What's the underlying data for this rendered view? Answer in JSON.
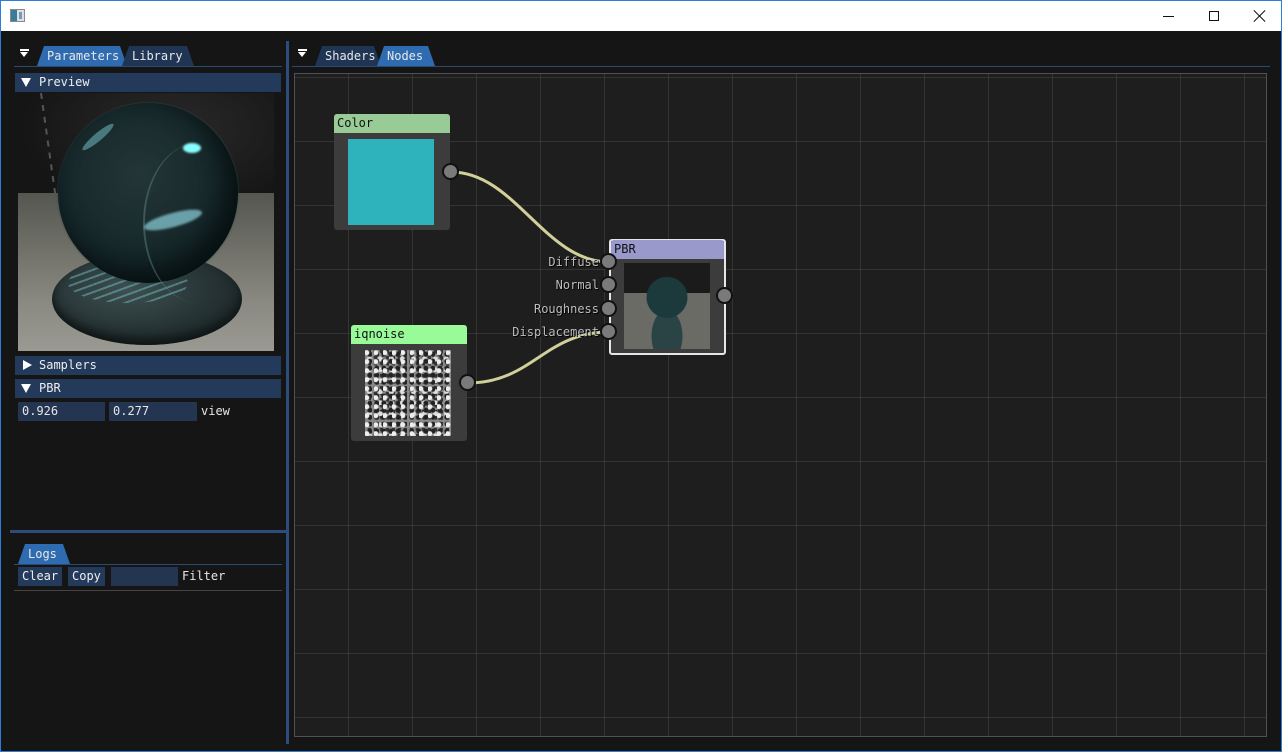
{
  "window": {
    "title": "",
    "controls": {
      "minimize": "minimize",
      "maximize": "maximize",
      "close": "close"
    }
  },
  "left_panel": {
    "tabs": [
      {
        "label": "Parameters",
        "active": true
      },
      {
        "label": "Library",
        "active": false
      }
    ],
    "sections": {
      "preview": {
        "label": "Preview",
        "expanded": true
      },
      "samplers": {
        "label": "Samplers",
        "expanded": false
      },
      "pbr": {
        "label": "PBR",
        "expanded": true
      }
    },
    "pbr_view": {
      "x": "0.926",
      "y": "0.277",
      "label": "view"
    }
  },
  "logs_panel": {
    "tabs": [
      {
        "label": "Logs",
        "active": true
      }
    ],
    "clear_label": "Clear",
    "copy_label": "Copy",
    "filter_value": "",
    "filter_label": "Filter"
  },
  "right_panel": {
    "tabs": [
      {
        "label": "Shaders",
        "active": false
      },
      {
        "label": "Nodes",
        "active": true
      }
    ]
  },
  "nodes": {
    "color": {
      "title": "Color",
      "title_color": "#98cb95",
      "swatch": "#2eb2bb"
    },
    "iqnoise": {
      "title": "iqnoise",
      "title_color": "#98fb98"
    },
    "pbr": {
      "title": "PBR",
      "title_color": "#9999cc",
      "inputs": [
        "Diffuse",
        "Normal",
        "Roughness",
        "Displacement"
      ],
      "selected": true
    }
  },
  "links": [
    {
      "from": "Color.out",
      "to": "PBR.Diffuse",
      "color": "#d2d09a"
    },
    {
      "from": "iqnoise.out",
      "to": "PBR.Displacement",
      "color": "#d2d09a"
    }
  ],
  "colors": {
    "accent": "#2f6bb0",
    "header_bg": "#243a5a",
    "background": "#151515",
    "canvas": "#1e1e1e"
  }
}
